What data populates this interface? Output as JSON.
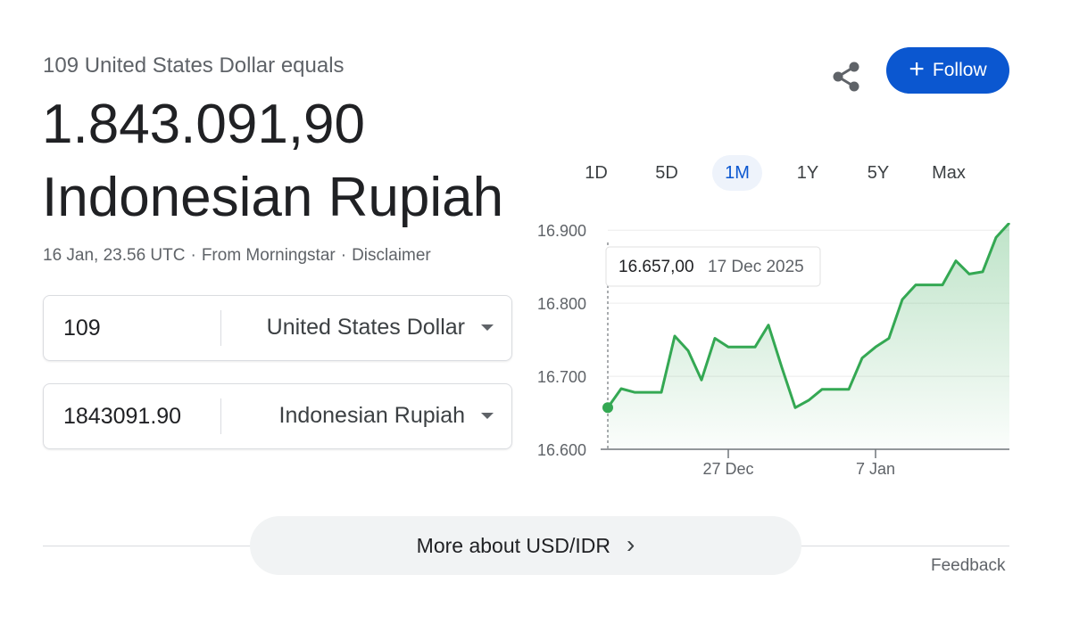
{
  "header": {
    "subtitle": "109 United States Dollar equals",
    "amount": "1.843.091,90",
    "currency_name": "Indonesian Rupiah",
    "timestamp": "16 Jan, 23.56 UTC",
    "source": "From Morningstar",
    "disclaimer": "Disclaimer",
    "separator": "·"
  },
  "actions": {
    "share_icon": "share-icon",
    "follow_icon": "+",
    "follow_label": "Follow",
    "accent_color": "#0b57d0"
  },
  "converter": {
    "from_value": "109",
    "from_currency": "United States Dollar",
    "to_value": "1843091.90",
    "to_currency": "Indonesian Rupiah"
  },
  "ranges": {
    "items": [
      "1D",
      "5D",
      "1M",
      "1Y",
      "5Y",
      "Max"
    ],
    "selected": "1M"
  },
  "tooltip": {
    "value": "16.657,00",
    "date": "17 Dec 2025"
  },
  "chart_data": {
    "type": "area",
    "x_ticks": [
      "27 Dec",
      "7 Jan"
    ],
    "y_ticks": [
      "16.600",
      "16.700",
      "16.800",
      "16.900"
    ],
    "ylim": [
      16600,
      16910
    ],
    "line_color": "#34a853",
    "grid": true,
    "values": [
      16657,
      16683,
      16678,
      16678,
      16678,
      16755,
      16735,
      16695,
      16752,
      16740,
      16740,
      16740,
      16770,
      16712,
      16657,
      16667,
      16682,
      16682,
      16682,
      16725,
      16740,
      16752,
      16805,
      16825,
      16825,
      16825,
      16858,
      16840,
      16843,
      16890,
      16910
    ]
  },
  "footer": {
    "more_label": "More about USD/IDR",
    "more_chevron": "›",
    "feedback": "Feedback"
  }
}
